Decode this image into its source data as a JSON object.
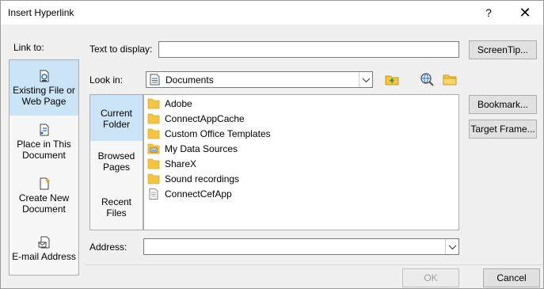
{
  "window": {
    "title": "Insert Hyperlink",
    "help_label": "?",
    "close_label": "✕"
  },
  "link_to": {
    "label": "Link to:",
    "items": [
      {
        "label": "Existing File or Web Page",
        "icon": "existing-file-icon",
        "selected": true
      },
      {
        "label": "Place in This Document",
        "icon": "place-in-document-icon",
        "selected": false
      },
      {
        "label": "Create New Document",
        "icon": "new-document-icon",
        "selected": false
      },
      {
        "label": "E-mail Address",
        "icon": "email-icon",
        "selected": false
      }
    ]
  },
  "text_to_display": {
    "label": "Text to display:",
    "value": ""
  },
  "screentip_label": "ScreenTip...",
  "look_in": {
    "label": "Look in:",
    "value": "Documents"
  },
  "browse": {
    "items": [
      {
        "label": "Current Folder",
        "selected": true
      },
      {
        "label": "Browsed Pages",
        "selected": false
      },
      {
        "label": "Recent Files",
        "selected": false
      }
    ]
  },
  "files": [
    {
      "name": "Adobe",
      "icon": "folder-icon"
    },
    {
      "name": "ConnectAppCache",
      "icon": "folder-icon"
    },
    {
      "name": "Custom Office Templates",
      "icon": "folder-icon"
    },
    {
      "name": "My Data Sources",
      "icon": "data-folder-icon"
    },
    {
      "name": "ShareX",
      "icon": "folder-icon"
    },
    {
      "name": "Sound recordings",
      "icon": "folder-icon"
    },
    {
      "name": "ConnectCefApp",
      "icon": "file-icon"
    }
  ],
  "bookmark_label": "Bookmark...",
  "target_frame_label": "Target Frame...",
  "address": {
    "label": "Address:",
    "value": ""
  },
  "ok_label": "OK",
  "cancel_label": "Cancel",
  "colors": {
    "selection": "#cce4f7",
    "folder": "#f6c443",
    "accent": "#0078d7"
  }
}
